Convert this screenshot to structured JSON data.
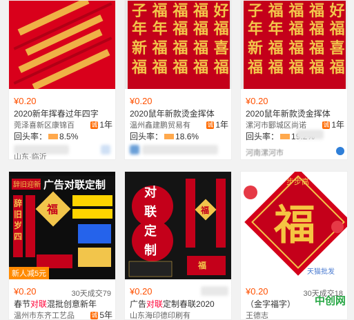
{
  "cards": [
    {
      "price": "¥0.20",
      "title": "2020新年挥春过年四字",
      "shop": "莞泽喜新区康锦百",
      "years": "1年",
      "rate_label": "回头率：",
      "rate": "8.5%",
      "location": "山东·临沂",
      "sold": "",
      "badge": ""
    },
    {
      "price": "¥0.20",
      "title": "2020鼠年新款烫金挥体",
      "shop": "温州鑫建鹏贸易有",
      "years": "1年",
      "rate_label": "回头率：",
      "rate": "18.6%",
      "location": "",
      "sold": "",
      "badge": ""
    },
    {
      "price": "¥0.20",
      "title": "2020鼠年新款烫金挥体",
      "shop": "漯河市郾城区尚诺",
      "years": "1年",
      "rate_label": "回头率：",
      "rate": "19.2%",
      "location": "河南漯河市",
      "sold": "",
      "badge": ""
    },
    {
      "price": "¥0.20",
      "title_pre": "春节",
      "title_hot": "对联",
      "title_post": "混批创意新年",
      "shop": "温州市东齐工艺品",
      "years": "5年",
      "sold": "30天成交79",
      "badge": "新人减5元",
      "img_banner": "辞旧迎新",
      "img_heading": "广告对联定制"
    },
    {
      "price": "¥0.20",
      "title_pre": "广告",
      "title_hot": "对联",
      "title_post": "定制春联2020",
      "shop": "山东海印德印刷有",
      "years": "",
      "sold": "",
      "badge": "",
      "img_words": [
        "对",
        "联",
        "定",
        "制"
      ]
    },
    {
      "price": "¥0.20",
      "title": "（金字福字）",
      "shop": "王德志",
      "years": "",
      "sold": "30天成交18",
      "badge": "",
      "img_char": "福",
      "img_top": "步步高",
      "img_corner": "天猫批发"
    }
  ],
  "watermark": "中创网",
  "colors": {
    "price": "#ff5000",
    "hot": "#ff0036",
    "red": "#c4001a",
    "gold": "#f5c542"
  }
}
